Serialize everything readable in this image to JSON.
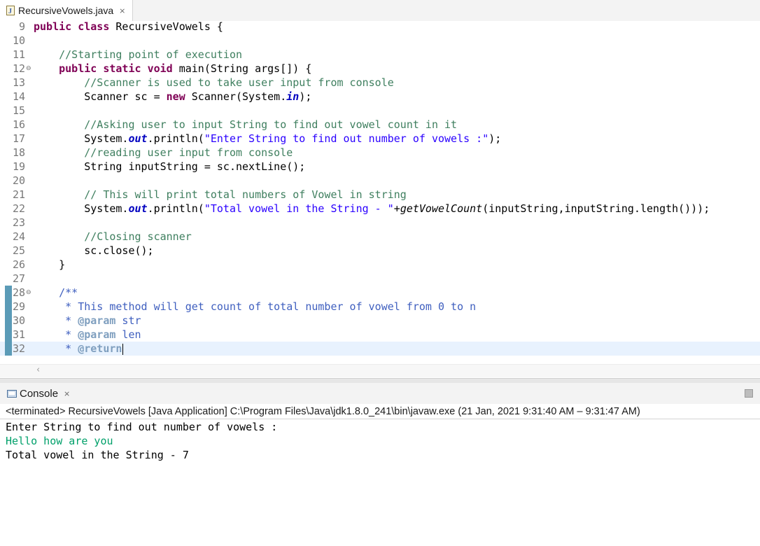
{
  "editor_tab": {
    "label": "RecursiveVowels.java",
    "icon": "java-file-icon",
    "close_icon": "close-icon"
  },
  "editor": {
    "lines": [
      {
        "num": "9",
        "parts": [
          [
            "kw",
            "public"
          ],
          [
            "",
            " "
          ],
          [
            "kw",
            "class"
          ],
          [
            "",
            " RecursiveVowels {"
          ]
        ]
      },
      {
        "num": "10",
        "parts": []
      },
      {
        "num": "11",
        "parts": [
          [
            "",
            "    "
          ],
          [
            "cm",
            "//Starting point of execution"
          ]
        ]
      },
      {
        "num": "12",
        "fold": true,
        "parts": [
          [
            "",
            "    "
          ],
          [
            "kw",
            "public"
          ],
          [
            "",
            " "
          ],
          [
            "kw",
            "static"
          ],
          [
            "",
            " "
          ],
          [
            "kw",
            "void"
          ],
          [
            "",
            " main(String args[]) {"
          ]
        ]
      },
      {
        "num": "13",
        "parts": [
          [
            "",
            "        "
          ],
          [
            "cm",
            "//Scanner is used to take user input from console"
          ]
        ]
      },
      {
        "num": "14",
        "parts": [
          [
            "",
            "        Scanner sc = "
          ],
          [
            "kw",
            "new"
          ],
          [
            "",
            " Scanner(System."
          ],
          [
            "fld",
            "in"
          ],
          [
            "",
            ");"
          ]
        ]
      },
      {
        "num": "15",
        "parts": []
      },
      {
        "num": "16",
        "parts": [
          [
            "",
            "        "
          ],
          [
            "cm",
            "//Asking user to input String to find out vowel count in it"
          ]
        ]
      },
      {
        "num": "17",
        "parts": [
          [
            "",
            "        System."
          ],
          [
            "fld",
            "out"
          ],
          [
            "",
            ".println("
          ],
          [
            "st",
            "\"Enter String to find out number of vowels :\""
          ],
          [
            "",
            ");"
          ]
        ]
      },
      {
        "num": "18",
        "parts": [
          [
            "",
            "        "
          ],
          [
            "cm",
            "//reading user input from console"
          ]
        ]
      },
      {
        "num": "19",
        "parts": [
          [
            "",
            "        String inputString = sc.nextLine();"
          ]
        ]
      },
      {
        "num": "20",
        "parts": []
      },
      {
        "num": "21",
        "parts": [
          [
            "",
            "        "
          ],
          [
            "cm",
            "// This will print total numbers of Vowel in string"
          ]
        ]
      },
      {
        "num": "22",
        "parts": [
          [
            "",
            "        System."
          ],
          [
            "fld",
            "out"
          ],
          [
            "",
            ".println("
          ],
          [
            "st",
            "\"Total vowel in the String - \""
          ],
          [
            "",
            "+"
          ],
          [
            "it",
            "getVowelCount"
          ],
          [
            "",
            "(inputString,inputString.length()));"
          ]
        ]
      },
      {
        "num": "23",
        "parts": []
      },
      {
        "num": "24",
        "parts": [
          [
            "",
            "        "
          ],
          [
            "cm",
            "//Closing scanner"
          ]
        ]
      },
      {
        "num": "25",
        "parts": [
          [
            "",
            "        sc.close();"
          ]
        ]
      },
      {
        "num": "26",
        "parts": [
          [
            "",
            "    }"
          ]
        ]
      },
      {
        "num": "27",
        "parts": []
      },
      {
        "num": "28",
        "fold": true,
        "marker": true,
        "parts": [
          [
            "",
            "    "
          ],
          [
            "jd",
            "/**"
          ]
        ]
      },
      {
        "num": "29",
        "marker": true,
        "parts": [
          [
            "",
            "     "
          ],
          [
            "jd",
            "* This method will get count of total number of vowel from 0 to n"
          ]
        ]
      },
      {
        "num": "30",
        "marker": true,
        "parts": [
          [
            "",
            "     "
          ],
          [
            "jd",
            "* "
          ],
          [
            "jt",
            "@param"
          ],
          [
            "jd",
            " str"
          ]
        ]
      },
      {
        "num": "31",
        "marker": true,
        "parts": [
          [
            "",
            "     "
          ],
          [
            "jd",
            "* "
          ],
          [
            "jt",
            "@param"
          ],
          [
            "jd",
            " len"
          ]
        ]
      },
      {
        "num": "32",
        "marker": true,
        "current": true,
        "caret": true,
        "parts": [
          [
            "",
            "     "
          ],
          [
            "jd",
            "* "
          ],
          [
            "jt",
            "@return"
          ]
        ]
      }
    ]
  },
  "console": {
    "tab_label": "Console",
    "icon": "console-icon",
    "close_icon": "close-icon",
    "toolbar_icon": "stop-icon",
    "status": "<terminated> RecursiveVowels [Java Application] C:\\Program Files\\Java\\jdk1.8.0_241\\bin\\javaw.exe  (21 Jan, 2021 9:31:40 AM – 9:31:47 AM)",
    "output": [
      {
        "text": "Enter String to find out number of vowels :",
        "type": "output"
      },
      {
        "text": "Hello how are you",
        "type": "input"
      },
      {
        "text": "Total vowel in the String - 7",
        "type": "output"
      }
    ],
    "colors": {
      "user_input": "#00a06a"
    }
  }
}
